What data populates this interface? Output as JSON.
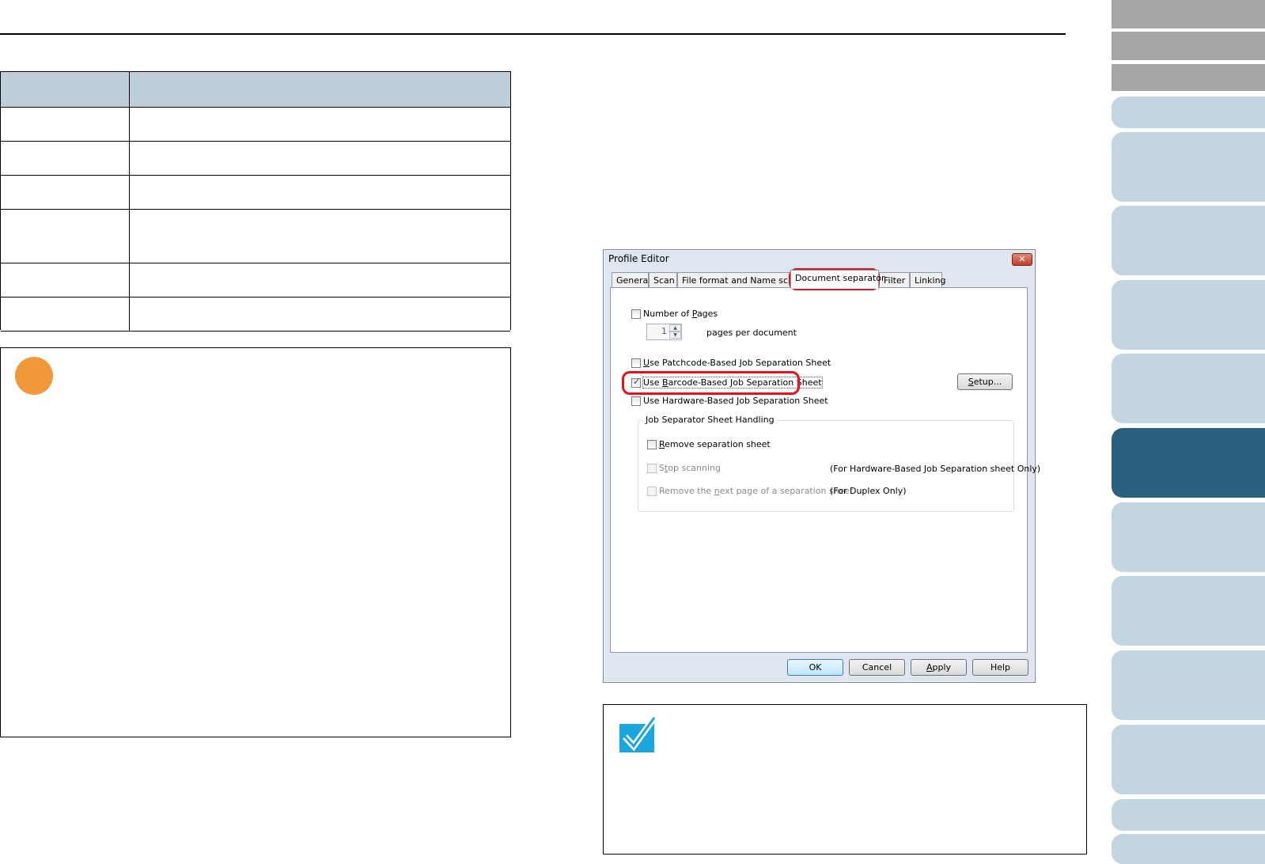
{
  "dialog": {
    "title": "Profile Editor",
    "close_glyph": "✕",
    "tabs": [
      {
        "label": "General",
        "active": false
      },
      {
        "label": "Scan",
        "active": false
      },
      {
        "label": "File format and Name scheme",
        "active": false
      },
      {
        "label": "Document separator",
        "active": true
      },
      {
        "label": "Filter",
        "active": false
      },
      {
        "label": "Linking",
        "active": false
      }
    ],
    "number_of_pages": {
      "pre": "Number of ",
      "key": "P",
      "post": "ages",
      "checked": false
    },
    "pages_value": "1",
    "pages_suffix": "pages per document",
    "patchcode": {
      "pre": "",
      "key": "U",
      "post": "se Patchcode-Based Job Separation Sheet",
      "checked": false
    },
    "barcode": {
      "pre": "Use ",
      "key": "B",
      "post": "arcode-Based Job Separation Sheet",
      "checked": true
    },
    "hardware": {
      "pre": "Use Hardware-Based ",
      "key": "J",
      "post": "ob Separation Sheet",
      "checked": false
    },
    "setup_button": {
      "pre": "",
      "key": "S",
      "post": "etup..."
    },
    "group_label": "Job Separator Sheet Handling",
    "remove_sheet": {
      "pre": "",
      "key": "R",
      "post": "emove separation sheet",
      "checked": false
    },
    "stop_scanning": {
      "pre": "S",
      "key": "t",
      "post": "op scanning",
      "checked": false,
      "disabled": true
    },
    "stop_note": "(For Hardware-Based Job Separation sheet Only)",
    "remove_next": {
      "pre": "Remove the ",
      "key": "n",
      "post": "ext page of a separation sheet",
      "checked": false,
      "disabled": true
    },
    "remove_next_note": "(For Duplex Only)",
    "buttons": {
      "ok": "OK",
      "cancel": "Cancel",
      "apply_key": "A",
      "apply_rest": "pply",
      "help": "Help"
    }
  },
  "colors": {
    "important_icon": "#f0983a",
    "hint_icon": "#1aa6df",
    "highlight": "#e8101a",
    "nav_active": "#2a5f7e",
    "nav_inactive": "#c3d5e0",
    "nav_top": "#a6a6a6",
    "table_header": "#bfcfd9"
  },
  "icons": {
    "important": "important-circle-icon",
    "hint": "checkmark-hint-icon"
  }
}
